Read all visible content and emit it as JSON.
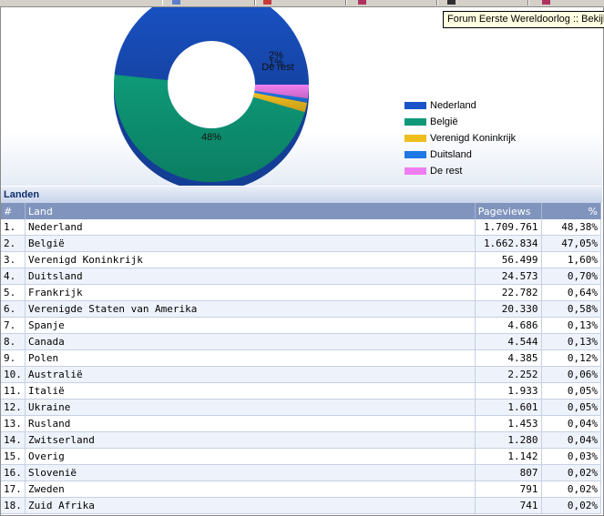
{
  "tooltip": "Forum Eerste Wereldoorlog :: Bekijk",
  "chart_data": {
    "type": "pie",
    "style": "donut",
    "categories": [
      "Nederland",
      "België",
      "Verenigd Koninkrijk",
      "Duitsland",
      "De rest"
    ],
    "values": [
      48.38,
      47.05,
      1.6,
      0.7,
      2.27
    ],
    "colors": [
      "#1a53c8",
      "#0e9a78",
      "#f0be1e",
      "#1e78e6",
      "#f07ef0"
    ],
    "data_labels": [
      "48%",
      "",
      "2%",
      "1%",
      "De rest"
    ],
    "legend_position": "right"
  },
  "section_title": "Landen",
  "table": {
    "headers": [
      "#",
      "Land",
      "Pageviews",
      "%"
    ],
    "rows": [
      [
        "1.",
        "Nederland",
        "1.709.761",
        "48,38%"
      ],
      [
        "2.",
        "België",
        "1.662.834",
        "47,05%"
      ],
      [
        "3.",
        "Verenigd Koninkrijk",
        "56.499",
        "1,60%"
      ],
      [
        "4.",
        "Duitsland",
        "24.573",
        "0,70%"
      ],
      [
        "5.",
        "Frankrijk",
        "22.782",
        "0,64%"
      ],
      [
        "6.",
        "Verenigde Staten van Amerika",
        "20.330",
        "0,58%"
      ],
      [
        "7.",
        "Spanje",
        "4.686",
        "0,13%"
      ],
      [
        "8.",
        "Canada",
        "4.544",
        "0,13%"
      ],
      [
        "9.",
        "Polen",
        "4.385",
        "0,12%"
      ],
      [
        "10.",
        "Australië",
        "2.252",
        "0,06%"
      ],
      [
        "11.",
        "Italië",
        "1.933",
        "0,05%"
      ],
      [
        "12.",
        "Ukraine",
        "1.601",
        "0,05%"
      ],
      [
        "13.",
        "Rusland",
        "1.453",
        "0,04%"
      ],
      [
        "14.",
        "Zwitserland",
        "1.280",
        "0,04%"
      ],
      [
        "15.",
        "Overig",
        "1.142",
        "0,03%"
      ],
      [
        "16.",
        "Slovenië",
        "807",
        "0,02%"
      ],
      [
        "17.",
        "Zweden",
        "791",
        "0,02%"
      ],
      [
        "18.",
        "Zuid Afrika",
        "741",
        "0,02%"
      ]
    ]
  }
}
